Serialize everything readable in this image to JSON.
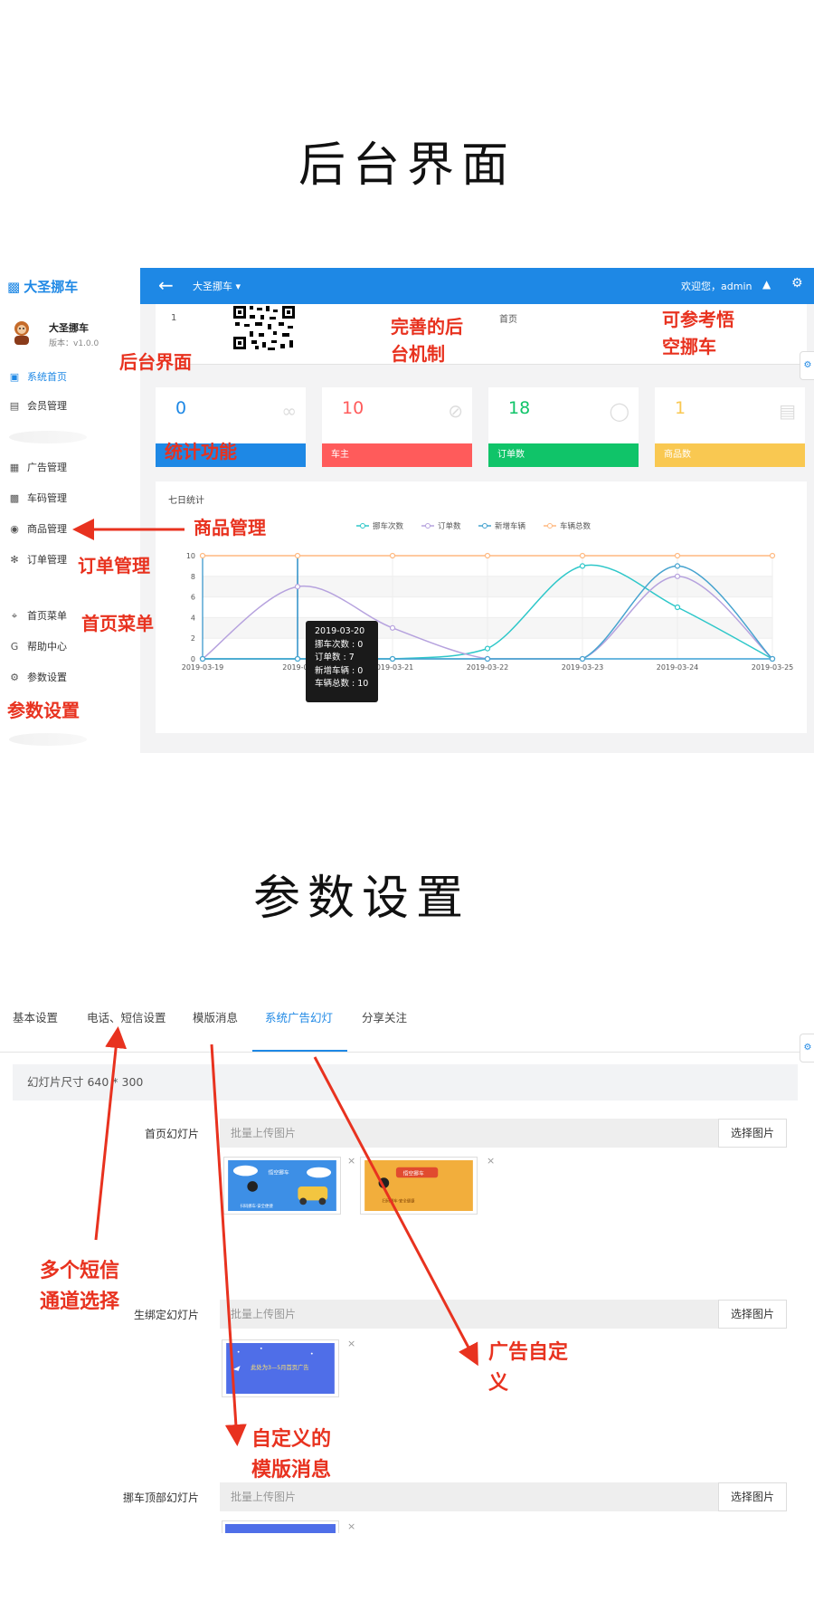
{
  "headings": {
    "backend": "后台界面",
    "params": "参数设置"
  },
  "sidebar": {
    "brand": "大圣挪车",
    "user_name": "大圣挪车",
    "version": "版本：v1.0.0",
    "items": [
      {
        "label": "系统首页",
        "icon": "home-icon",
        "active": true
      },
      {
        "label": "会员管理",
        "icon": "member-icon"
      },
      {
        "label": "广告管理",
        "icon": "image-icon"
      },
      {
        "label": "车码管理",
        "icon": "car-icon"
      },
      {
        "label": "商品管理",
        "icon": "compass-icon"
      },
      {
        "label": "订单管理",
        "icon": "fan-icon"
      },
      {
        "label": "首页菜单",
        "icon": "crosshair-icon"
      },
      {
        "label": "帮助中心",
        "icon": "g-icon"
      },
      {
        "label": "参数设置",
        "icon": "gear-icon"
      }
    ]
  },
  "topbar": {
    "title": "大圣挪车 ▾",
    "welcome": "欢迎您，admin"
  },
  "info_panel": {
    "number": "1",
    "home_label": "首页"
  },
  "stat_cards": [
    {
      "value": "0",
      "label": "",
      "color": "#1e88e5",
      "value_color": "#1e88e5"
    },
    {
      "value": "10",
      "label": "车主",
      "color": "#ff5b5b",
      "value_color": "#ff5b5b"
    },
    {
      "value": "18",
      "label": "订单数",
      "color": "#10c469",
      "value_color": "#10c469"
    },
    {
      "value": "1",
      "label": "商品数",
      "color": "#f9c851",
      "value_color": "#f9c851"
    }
  ],
  "chart_title": "七日统计",
  "chart_data": {
    "type": "line",
    "x": [
      "2019-03-19",
      "2019-03-20",
      "2019-03-21",
      "2019-03-22",
      "2019-03-23",
      "2019-03-24",
      "2019-03-25"
    ],
    "ylim": [
      0,
      10
    ],
    "yticks": [
      0,
      2,
      4,
      6,
      8,
      10
    ],
    "legend_position": "top-center",
    "series": [
      {
        "name": "挪车次数",
        "color": "#2ec7c9",
        "values": [
          0,
          0,
          0,
          1,
          9,
          5,
          0
        ]
      },
      {
        "name": "订单数",
        "color": "#b6a2de",
        "values": [
          0,
          7,
          3,
          0,
          0,
          8,
          0
        ]
      },
      {
        "name": "新增车辆",
        "color": "#46a3cf",
        "values": [
          0,
          0,
          0,
          0,
          0,
          9,
          0
        ]
      },
      {
        "name": "车辆总数",
        "color": "#ffb980",
        "values": [
          10,
          10,
          10,
          10,
          10,
          10,
          10
        ]
      }
    ],
    "x_visible_labels": [
      "2019-03-19",
      "2019-03",
      "2019-03-21",
      "2019-03-22",
      "2019-03-23",
      "2019-03-24",
      "2019-03-25"
    ]
  },
  "tooltip": {
    "date": "2019-03-20",
    "lines": [
      "挪车次数 : 0",
      "订单数 : 7",
      "新增车辆 : 0",
      "车辆总数 : 10"
    ]
  },
  "annotations_top": {
    "backend_ui": "后台界面",
    "complete": "完善的后\n台机制",
    "reference": "可参考悟\n空挪车",
    "stats": "统计功能",
    "goods": "商品管理",
    "orders": "订单管理",
    "menu": "首页菜单",
    "params": "参数设置"
  },
  "settings": {
    "tabs": [
      "基本设置",
      "电话、短信设置",
      "模版消息",
      "系统广告幻灯",
      "分享关注"
    ],
    "active_tab": 3,
    "size_hint": "幻灯片尺寸 640 * 300",
    "rows": [
      {
        "label": "首页幻灯片",
        "placeholder": "批量上传图片",
        "button": "选择图片"
      },
      {
        "label": "生绑定幻灯片",
        "placeholder": "批量上传图片",
        "button": "选择图片"
      },
      {
        "label": "挪车顶部幻灯片",
        "placeholder": "批量上传图片",
        "button": "选择图片"
      }
    ],
    "thumb_texts": {
      "t1_top": "悟空挪车",
      "t1_bottom": "扫码挪车·安全便捷",
      "t2_badge": "悟空挪车",
      "t2_bottom": "扫码挪车·安全便捷",
      "t3_title": "此处为3—5月首页广告"
    }
  },
  "annotations_bottom": {
    "sms": "多个短信\n通道选择",
    "ads": "广告自定\n义",
    "template": "自定义的\n模版消息"
  }
}
